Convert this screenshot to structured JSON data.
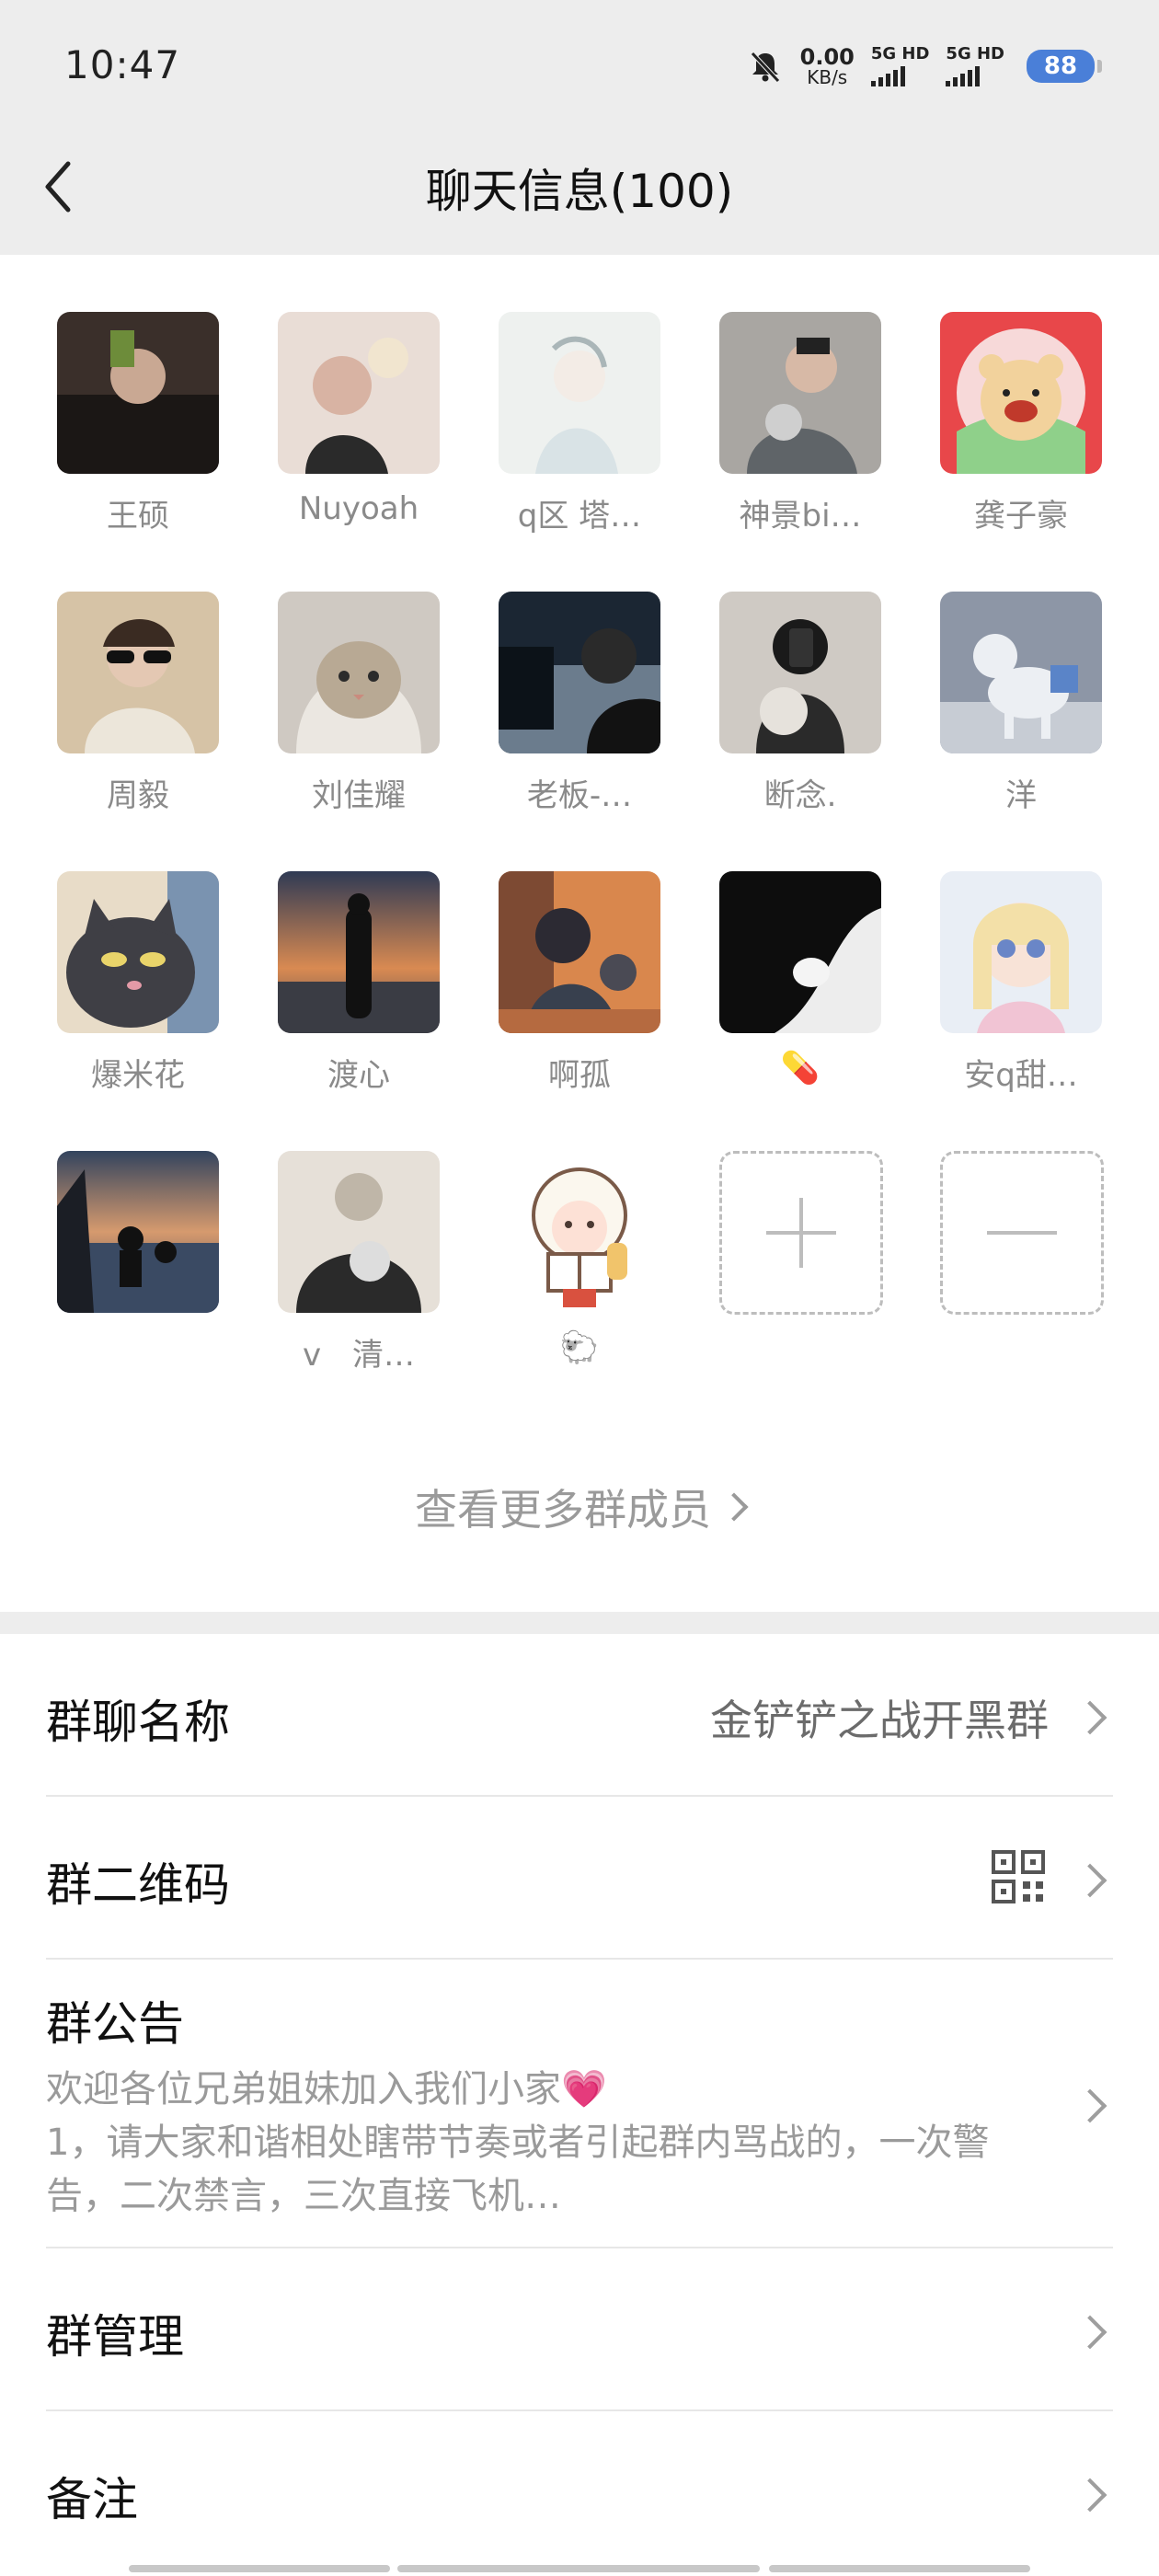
{
  "status_bar": {
    "time": "10:47",
    "net_speed_value": "0.00",
    "net_speed_unit": "KB/s",
    "sim1": "5G HD",
    "sim2": "5G HD",
    "battery": "88"
  },
  "header": {
    "title": "聊天信息(100)"
  },
  "members": [
    {
      "name": "王硕",
      "avatar_icon": "avatar-photo"
    },
    {
      "name": "Nuyoah",
      "avatar_icon": "avatar-photo"
    },
    {
      "name": "q区 塔…",
      "avatar_icon": "avatar-photo"
    },
    {
      "name": "神景bi…",
      "avatar_icon": "avatar-photo"
    },
    {
      "name": "龚子豪",
      "avatar_icon": "avatar-cartoon-bear"
    },
    {
      "name": "周毅",
      "avatar_icon": "avatar-photo"
    },
    {
      "name": "刘佳耀",
      "avatar_icon": "avatar-cat"
    },
    {
      "name": "老板-…",
      "avatar_icon": "avatar-photo"
    },
    {
      "name": "断念.",
      "avatar_icon": "avatar-photo"
    },
    {
      "name": "洋",
      "avatar_icon": "avatar-dog"
    },
    {
      "name": "爆米花",
      "avatar_icon": "avatar-cartoon-cat"
    },
    {
      "name": "渡心",
      "avatar_icon": "avatar-silhouette"
    },
    {
      "name": "啊孤",
      "avatar_icon": "avatar-anime"
    },
    {
      "name": "💊",
      "avatar_icon": "avatar-black-cat"
    },
    {
      "name": "安q甜…",
      "avatar_icon": "avatar-doll"
    },
    {
      "name": "",
      "avatar_icon": "avatar-landscape"
    },
    {
      "name": "v　清…",
      "avatar_icon": "avatar-photo"
    },
    {
      "name": "🐑",
      "avatar_icon": "avatar-cartoon-sheep"
    }
  ],
  "actions": {
    "add_icon": "plus-icon",
    "remove_icon": "minus-icon"
  },
  "view_more": "查看更多群成员",
  "settings": {
    "group_name_label": "群聊名称",
    "group_name_value": "金铲铲之战开黑群",
    "qr_label": "群二维码",
    "notice_label": "群公告",
    "notice_text": "欢迎各位兄弟姐妹加入我们小家💗\n1，请大家和谐相处瞎带节奏或者引起群内骂战的，一次警告，二次禁言，三次直接飞机…",
    "manage_label": "群管理",
    "remark_label": "备注"
  },
  "colors": {
    "header_bg": "#ededed",
    "battery": "#4a7fd8",
    "muted_text": "#8a8a8a"
  }
}
